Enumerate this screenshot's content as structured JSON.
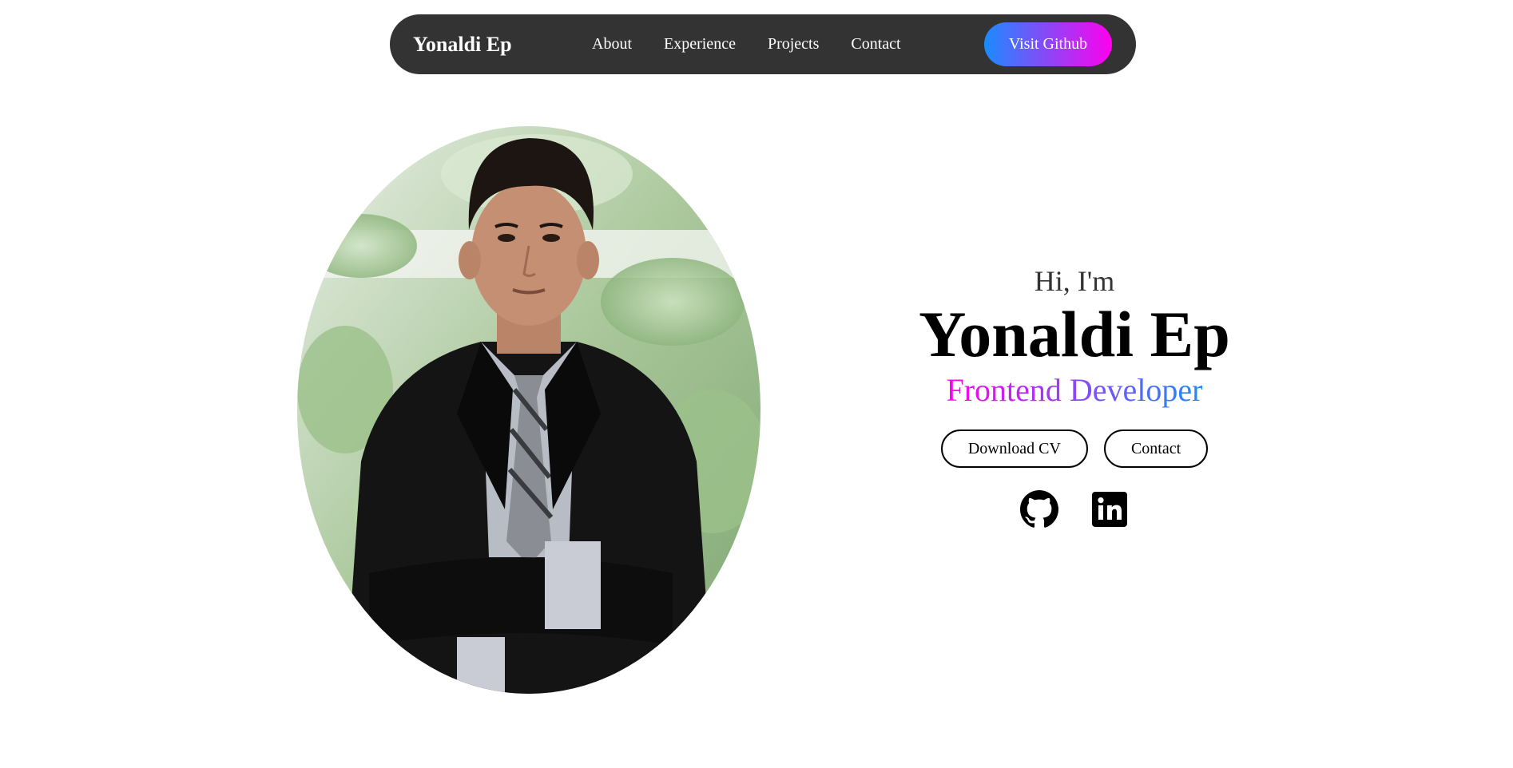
{
  "navbar": {
    "brand": "Yonaldi Ep",
    "links": [
      {
        "label": "About"
      },
      {
        "label": "Experience"
      },
      {
        "label": "Projects"
      },
      {
        "label": "Contact"
      }
    ],
    "cta_label": "Visit Github"
  },
  "hero": {
    "greeting": "Hi, I'm",
    "name": "Yonaldi Ep",
    "role": "Frontend Developer",
    "buttons": [
      {
        "label": "Download CV"
      },
      {
        "label": "Contact"
      }
    ],
    "social": [
      {
        "icon": "github-icon"
      },
      {
        "icon": "linkedin-icon"
      }
    ]
  },
  "colors": {
    "navbar_bg": "#333333",
    "gradient_blue": "#1a8cff",
    "gradient_magenta": "#ff00ee"
  }
}
